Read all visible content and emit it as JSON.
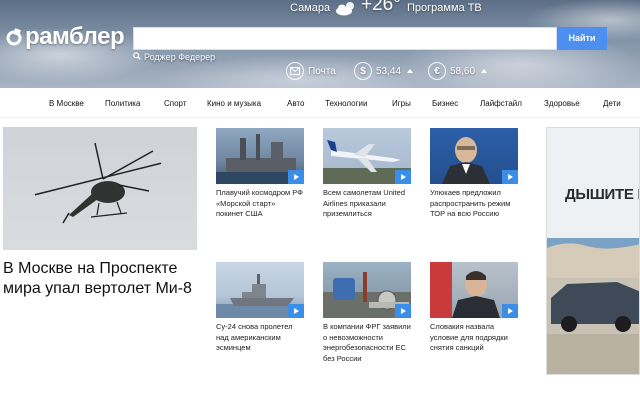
{
  "header": {
    "logo_text": "рамблер",
    "city": "Самара",
    "weather_icon": "cloud-sun-icon",
    "temperature": "+26°",
    "tv_link": "Программа ТВ",
    "search": {
      "value": "",
      "placeholder": "",
      "button_label": "Найти"
    },
    "suggestion": "Роджер Федерер",
    "tickers": [
      {
        "icon": "mail-icon",
        "label": "Почта"
      },
      {
        "icon": "dollar-icon",
        "label": "53,44"
      },
      {
        "icon": "euro-icon",
        "label": "58,60"
      }
    ]
  },
  "nav": {
    "items": [
      "В Москве",
      "Политика",
      "Спорт",
      "Кино и музыка",
      "Авто",
      "Технологии",
      "Игры",
      "Бизнес",
      "Лайфстайл",
      "Здоровье",
      "Дети"
    ]
  },
  "main_story": {
    "title": "В Москве на Проспекте мира упал вертолет Ми-8"
  },
  "cards": [
    {
      "text": "Плавучий космодром РФ «Морской старт» покинет США"
    },
    {
      "text": "Всем самолетам United Airlines приказали приземлиться"
    },
    {
      "text": "Улюкаев предложил распространить режим ТОР на всю Россию"
    },
    {
      "text": "Су-24 снова пролетел над американским эсминцем"
    },
    {
      "text": "В компании ФРГ заявили о невозможности энергобезопасности ЕС без России"
    },
    {
      "text": "Словакия назвала условие для подрядки снятия санкций"
    }
  ],
  "ad": {
    "text": "ДЫШИТЕ ГЛ"
  },
  "colors": {
    "accent": "#4d8ff0",
    "play": "#3b8ee8"
  }
}
